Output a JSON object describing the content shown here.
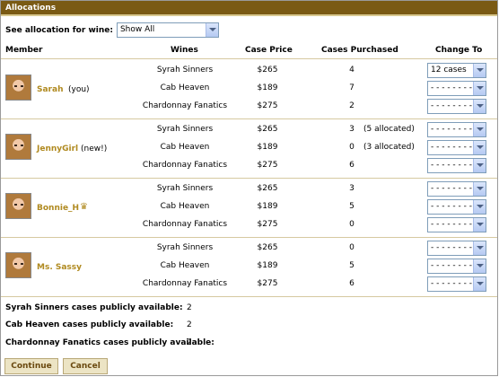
{
  "title": "Allocations",
  "filter": {
    "label": "See allocation for wine:",
    "selected": "Show All"
  },
  "columns": {
    "member": "Member",
    "wines": "Wines",
    "price": "Case Price",
    "purchased": "Cases Purchased",
    "change": "Change To"
  },
  "members": [
    {
      "name": "Sarah",
      "tag": "(you)",
      "rows": [
        {
          "wine": "Syrah Sinners",
          "price": "$265",
          "qty": "4",
          "alloc": "",
          "change": "12 cases"
        },
        {
          "wine": "Cab Heaven",
          "price": "$189",
          "qty": "7",
          "alloc": "",
          "change": "- - - - - - - -"
        },
        {
          "wine": "Chardonnay Fanatics",
          "price": "$275",
          "qty": "2",
          "alloc": "",
          "change": "- - - - - - - -"
        }
      ]
    },
    {
      "name": "JennyGirl",
      "tag": "(new!)",
      "rows": [
        {
          "wine": "Syrah Sinners",
          "price": "$265",
          "qty": "3",
          "alloc": "(5 allocated)",
          "change": "- - - - - - - -"
        },
        {
          "wine": "Cab Heaven",
          "price": "$189",
          "qty": "0",
          "alloc": "(3 allocated)",
          "change": "- - - - - - - -"
        },
        {
          "wine": "Chardonnay Fanatics",
          "price": "$275",
          "qty": "6",
          "alloc": "",
          "change": "- - - - - - - -"
        }
      ]
    },
    {
      "name": "Bonnie_H",
      "tag": "",
      "rows": [
        {
          "wine": "Syrah Sinners",
          "price": "$265",
          "qty": "3",
          "alloc": "",
          "change": "- - - - - - - -"
        },
        {
          "wine": "Cab Heaven",
          "price": "$189",
          "qty": "5",
          "alloc": "",
          "change": "- - - - - - - -"
        },
        {
          "wine": "Chardonnay Fanatics",
          "price": "$275",
          "qty": "0",
          "alloc": "",
          "change": "- - - - - - - -"
        }
      ]
    },
    {
      "name": "Ms. Sassy",
      "tag": "",
      "rows": [
        {
          "wine": "Syrah Sinners",
          "price": "$265",
          "qty": "0",
          "alloc": "",
          "change": "- - - - - - - -"
        },
        {
          "wine": "Cab Heaven",
          "price": "$189",
          "qty": "5",
          "alloc": "",
          "change": "- - - - - - - -"
        },
        {
          "wine": "Chardonnay Fanatics",
          "price": "$275",
          "qty": "6",
          "alloc": "",
          "change": "- - - - - - - -"
        }
      ]
    }
  ],
  "availability": [
    {
      "label": "Syrah Sinners cases publicly available:",
      "value": "2"
    },
    {
      "label": "Cab Heaven cases publicly available:",
      "value": "2"
    },
    {
      "label": "Chardonnay Fanatics cases publicly available:",
      "value": "2"
    }
  ],
  "buttons": {
    "continue": "Continue",
    "cancel": "Cancel"
  },
  "colors": {
    "titlebar": "#7a5a14",
    "member_name": "#b08a20",
    "button_bg": "#ece4c4"
  },
  "icons": {
    "crown": "crown-icon",
    "dropdown": "chevron-down-icon"
  }
}
